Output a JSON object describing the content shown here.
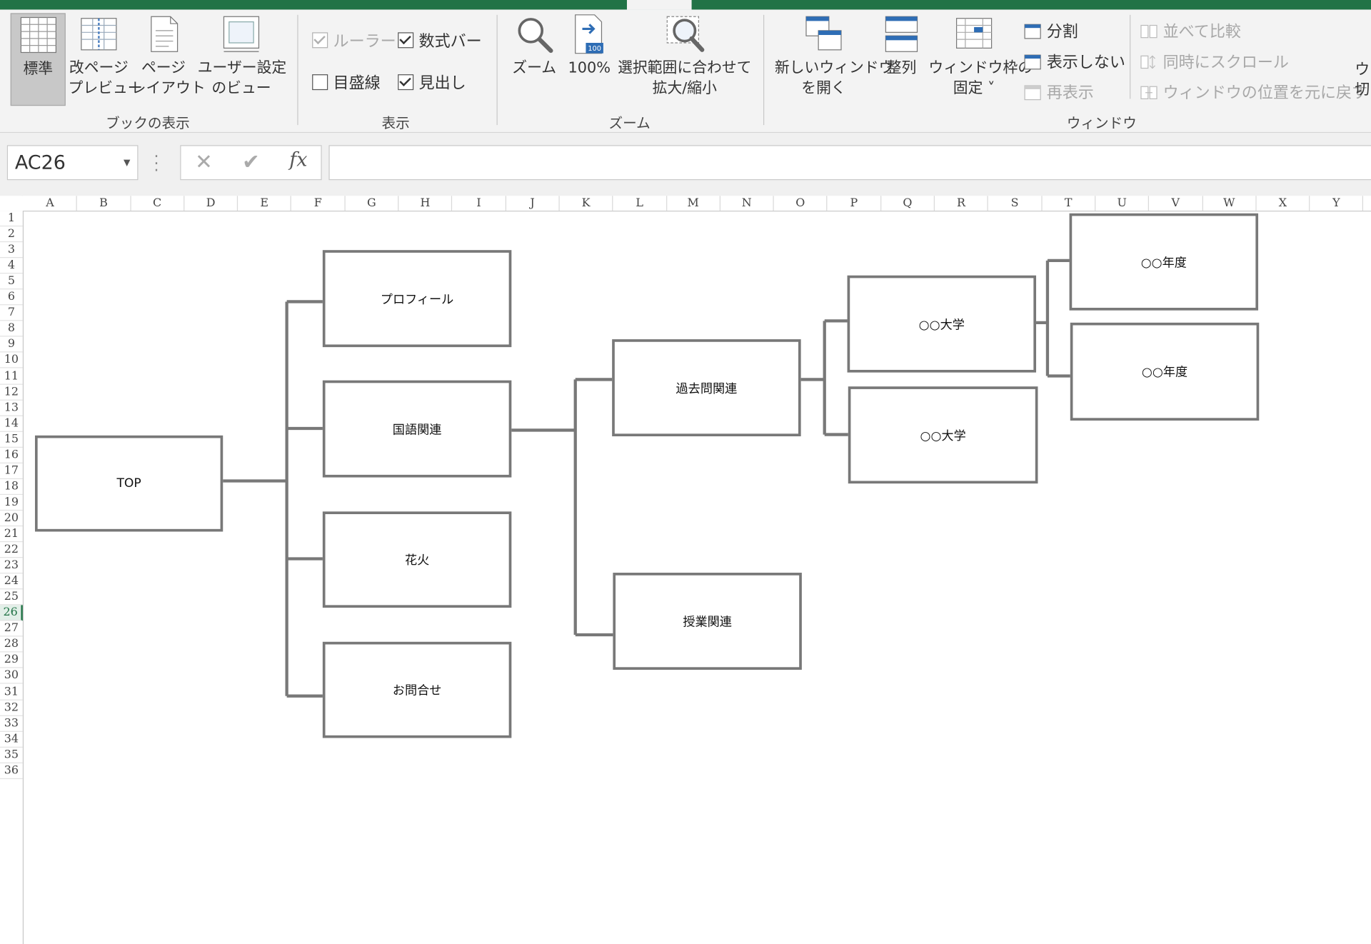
{
  "ribbon": {
    "groups": {
      "book_view": {
        "label": "ブックの表示",
        "normal": "標準",
        "page_break_1": "改ページ",
        "page_break_2": "プレビュー",
        "page_layout_1": "ページ",
        "page_layout_2": "レイアウト",
        "custom_views_1": "ユーザー設定",
        "custom_views_2": "のビュー"
      },
      "show": {
        "label": "表示",
        "ruler": "ルーラー",
        "formula_bar": "数式バー",
        "gridlines": "目盛線",
        "headings": "見出し"
      },
      "zoom": {
        "label": "ズーム",
        "zoom": "ズーム",
        "zoom100": "100%",
        "zoom100_icon_text": "100",
        "zoom_selection_1": "選択範囲に合わせて",
        "zoom_selection_2": "拡大/縮小"
      },
      "window": {
        "label": "ウィンドウ",
        "new_window_1": "新しいウィンドウ",
        "new_window_2": "を開く",
        "arrange": "整列",
        "freeze_1": "ウィンドウ枠の",
        "freeze_2": "固定 ˅",
        "split": "分割",
        "hide": "表示しない",
        "unhide": "再表示",
        "side_by_side": "並べて比較",
        "sync_scroll": "同時にスクロール",
        "reset_position": "ウィンドウの位置を元に戻す",
        "switch_partial_1": "ウ",
        "switch_partial_2": "切"
      }
    }
  },
  "formula_bar": {
    "name_box": "AC26",
    "fx": "fx",
    "value": ""
  },
  "columns": [
    "A",
    "B",
    "C",
    "D",
    "E",
    "F",
    "G",
    "H",
    "I",
    "J",
    "K",
    "L",
    "M",
    "N",
    "O",
    "P",
    "Q",
    "R",
    "S",
    "T",
    "U",
    "V",
    "W",
    "X",
    "Y"
  ],
  "rows": [
    "1",
    "2",
    "3",
    "4",
    "5",
    "6",
    "7",
    "8",
    "9",
    "10",
    "11",
    "12",
    "13",
    "14",
    "15",
    "16",
    "17",
    "18",
    "19",
    "20",
    "21",
    "22",
    "23",
    "24",
    "25",
    "26",
    "27",
    "28",
    "29",
    "30",
    "31",
    "32",
    "33",
    "34",
    "35",
    "36"
  ],
  "selected_row": "26",
  "diagram": {
    "top": "TOP",
    "profile": "プロフィール",
    "kokugo": "国語関連",
    "hanabi": "花火",
    "contact": "お問合せ",
    "kakomon": "過去問関連",
    "jugyo": "授業関連",
    "univ1": "○○大学",
    "univ2": "○○大学",
    "year1": "○○年度",
    "year2": "○○年度"
  }
}
